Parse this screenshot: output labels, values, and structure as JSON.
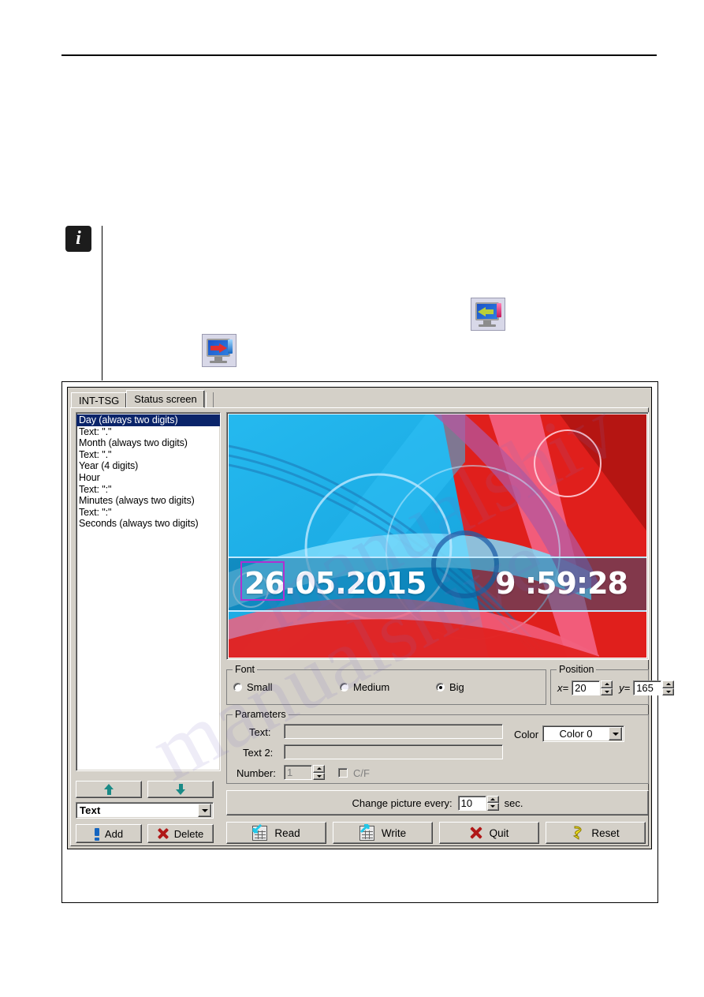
{
  "document": {
    "watermark_line1": "manualshive.com",
    "watermark_line2": "manualshive"
  },
  "icons": {
    "info": "i",
    "inline_read_icon": "monitor-read-icon",
    "inline_write_icon": "monitor-write-icon"
  },
  "dialog": {
    "tabs": [
      {
        "label": "INT-TSG",
        "active": false
      },
      {
        "label": "Status screen",
        "active": true
      }
    ],
    "list": {
      "items": [
        {
          "label": "Day (always two digits)",
          "selected": true
        },
        {
          "label": "Text: \".\"",
          "selected": false
        },
        {
          "label": "Month (always two digits)",
          "selected": false
        },
        {
          "label": "Text: \".\"",
          "selected": false
        },
        {
          "label": "Year (4 digits)",
          "selected": false
        },
        {
          "label": "Hour",
          "selected": false
        },
        {
          "label": "Text: \":\"",
          "selected": false
        },
        {
          "label": "Minutes (always two digits)",
          "selected": false
        },
        {
          "label": "Text: \":\"",
          "selected": false
        },
        {
          "label": "Seconds (always two digits)",
          "selected": false
        }
      ]
    },
    "move_up_label": "",
    "move_down_label": "",
    "type_combo": {
      "value": "Text"
    },
    "add_button": "Add",
    "delete_button": "Delete",
    "preview": {
      "date": "26.05.2015",
      "time": "9 :59:28",
      "background_blue": "#14b0e8",
      "background_red": "#e8201e",
      "selection_color": "#b030d0"
    },
    "font_group": {
      "legend": "Font",
      "options": [
        {
          "label": "Small",
          "selected": false
        },
        {
          "label": "Medium",
          "selected": false
        },
        {
          "label": "Big",
          "selected": true
        }
      ]
    },
    "position_group": {
      "legend": "Position",
      "x_label": "x=",
      "x_value": "20",
      "y_label": "y=",
      "y_value": "165"
    },
    "parameters_group": {
      "legend": "Parameters",
      "text_label": "Text:",
      "text_value": "",
      "text2_label": "Text 2:",
      "text2_value": "",
      "number_label": "Number:",
      "number_value": "1",
      "cf_label": "C/F",
      "cf_checked": false,
      "color_label": "Color",
      "color_value": "Color 0"
    },
    "change_picture": {
      "label": "Change picture every:",
      "value": "10",
      "unit": "sec."
    },
    "buttons": {
      "read": "Read",
      "write": "Write",
      "quit": "Quit",
      "reset": "Reset"
    }
  }
}
